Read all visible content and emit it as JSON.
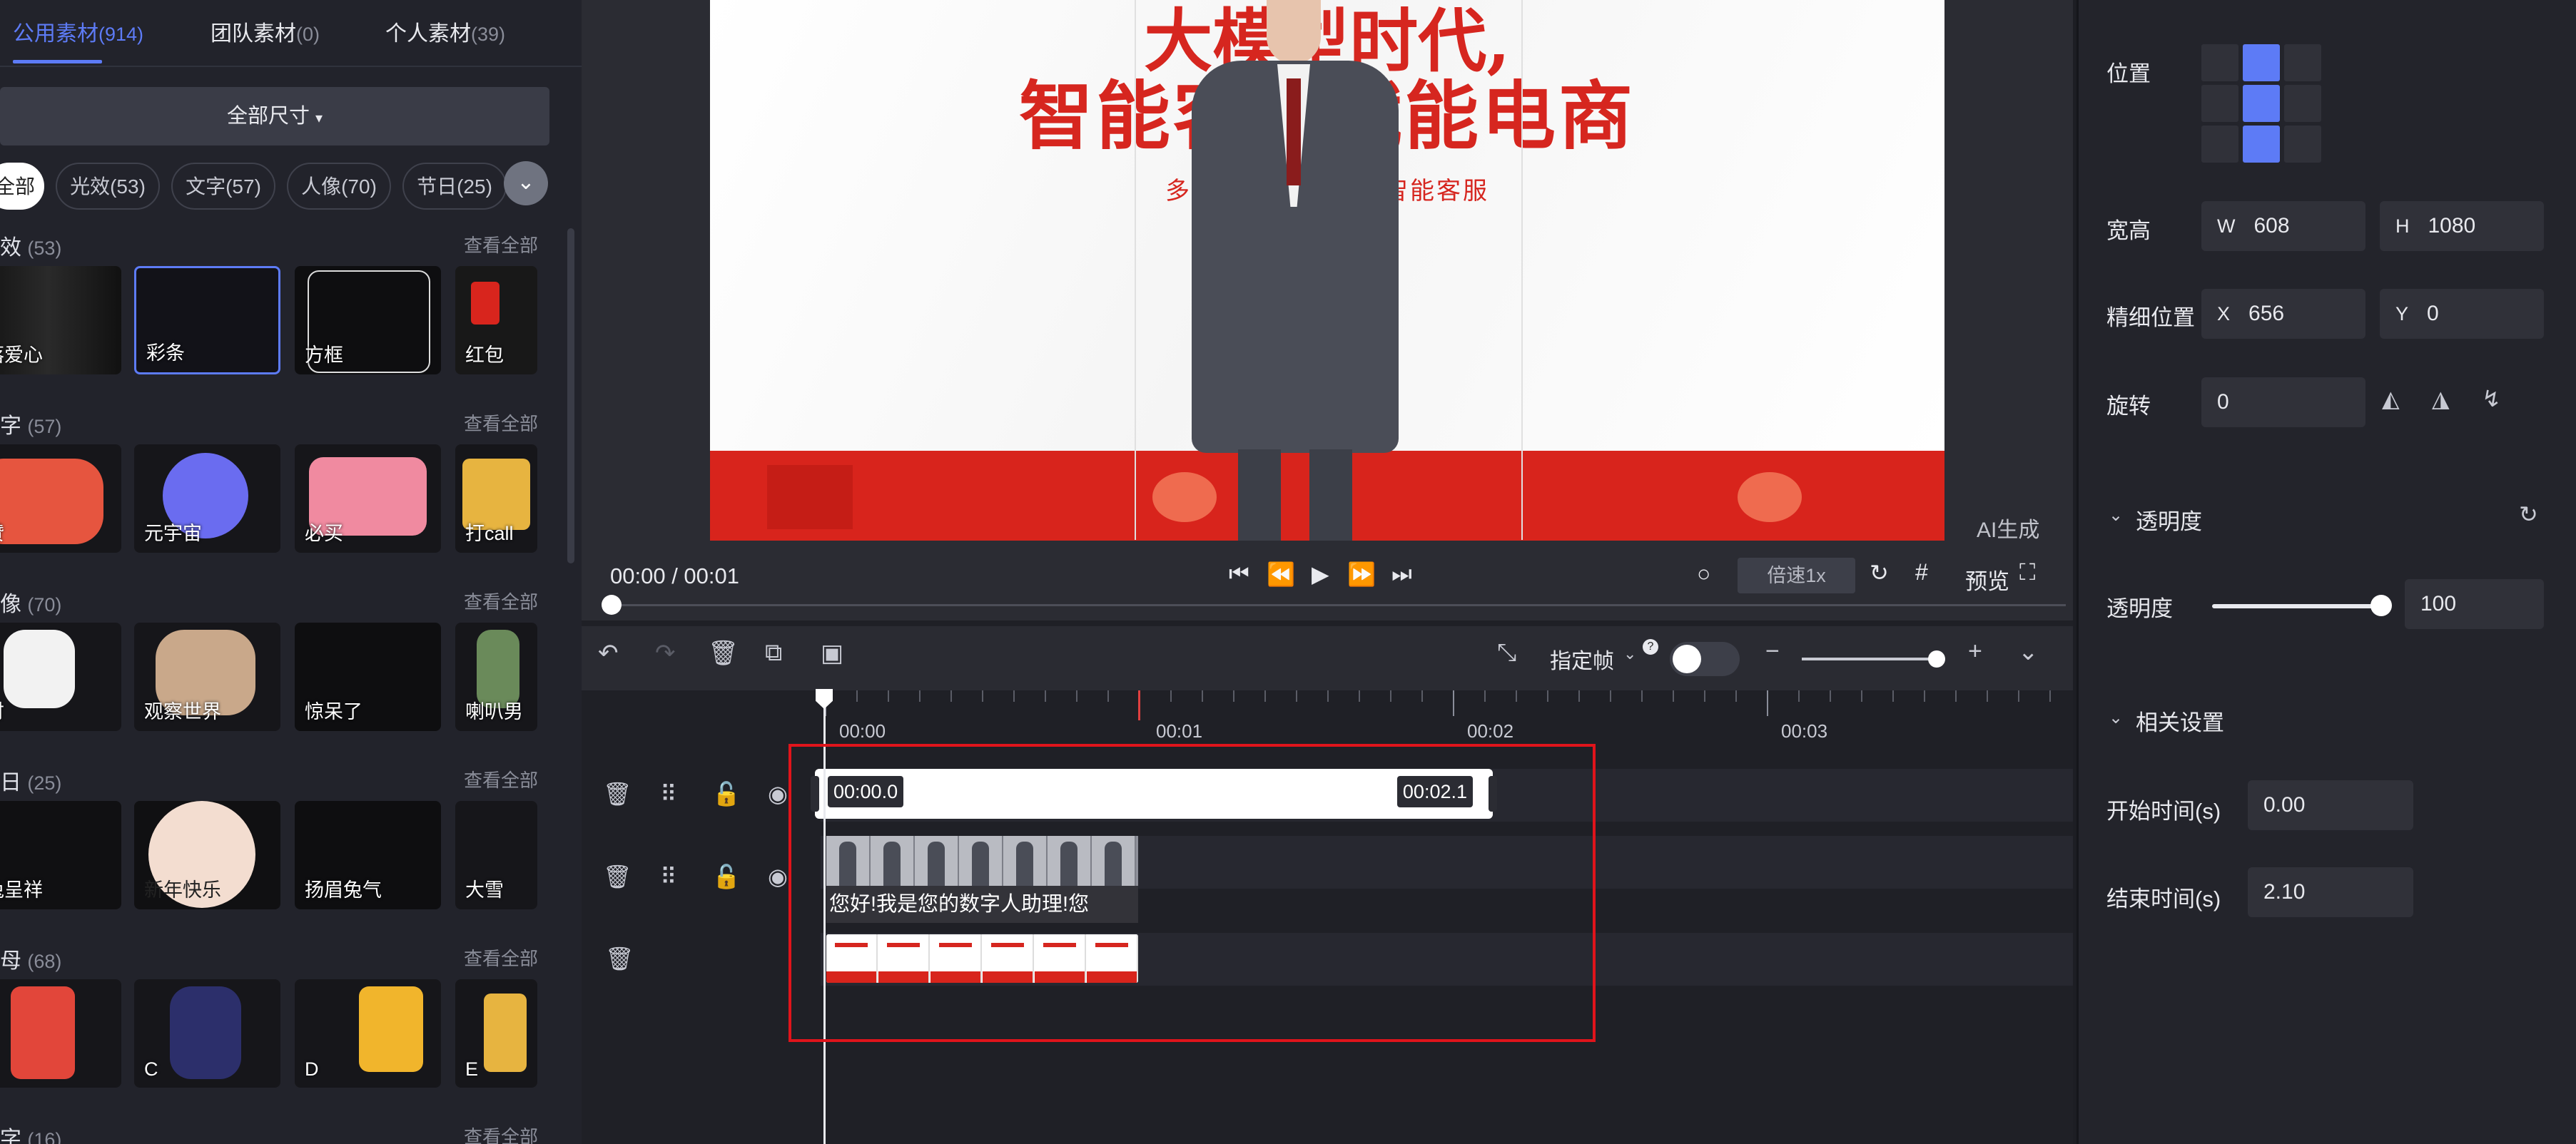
{
  "library": {
    "tabs": [
      {
        "label": "公用素材",
        "count": "(914)"
      },
      {
        "label": "团队素材",
        "count": "(0)"
      },
      {
        "label": "个人素材",
        "count": "(39)"
      }
    ],
    "size_filter": "全部尺寸",
    "chips": [
      "全部",
      "光效(53)",
      "文字(57)",
      "人像(70)",
      "节日(25)"
    ],
    "see_all": "查看全部",
    "sections": [
      {
        "title": "效",
        "count": "(53)",
        "items": [
          "落爱心",
          "彩条",
          "方框",
          "红包"
        ]
      },
      {
        "title": "字",
        "count": "(57)",
        "items": [
          "赞",
          "元宇宙",
          "必买",
          "打call"
        ]
      },
      {
        "title": "像",
        "count": "(70)",
        "items": [
          "财",
          "观察世界",
          "惊呆了",
          "喇叭男"
        ]
      },
      {
        "title": "日",
        "count": "(25)",
        "items": [
          "兔呈祥",
          "新年快乐",
          "扬眉兔气",
          "大雪"
        ]
      },
      {
        "title": "母",
        "count": "(68)",
        "items": [
          "",
          "C",
          "D",
          "E"
        ]
      },
      {
        "title": "字",
        "count": "(16)"
      }
    ]
  },
  "preview": {
    "video_title_line1": "大模型时代,",
    "video_title_line2": "智能客服赋能电商",
    "video_subtitle": "多模态AI Sale  •  智能客服",
    "ai_generated": "AI生成",
    "timecode": "00:00 / 00:01",
    "speed": "倍速1x",
    "preview_label": "预览",
    "progress": 0
  },
  "timeline": {
    "keyframe_label": "指定帧",
    "ruler": [
      "00:00",
      "00:01",
      "00:02",
      "00:03"
    ],
    "clip_start": "00:00.0",
    "clip_end": "00:02.1",
    "caption": "您好!我是您的数字人助理!您"
  },
  "properties": {
    "position_label": "位置",
    "size_label": "宽高",
    "width_prefix": "W",
    "width": "608",
    "height_prefix": "H",
    "height": "1080",
    "fine_pos_label": "精细位置",
    "x_prefix": "X",
    "x": "656",
    "y_prefix": "Y",
    "y": "0",
    "rotate_label": "旋转",
    "rotate": "0",
    "opacity_section": "透明度",
    "opacity_label": "透明度",
    "opacity": "100",
    "related_section": "相关设置",
    "start_label": "开始时间(s)",
    "start": "0.00",
    "end_label": "结束时间(s)",
    "end": "2.10"
  },
  "colors": {
    "accent": "#5d7bf6",
    "highlight_box": "#e0141b",
    "video_red": "#d6261f"
  }
}
